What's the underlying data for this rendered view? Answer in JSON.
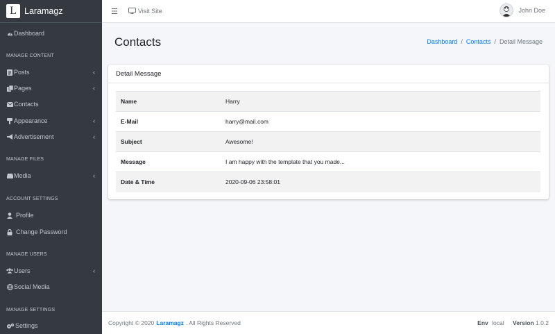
{
  "brand": {
    "logo_letter": "L",
    "name": "Laramagz"
  },
  "sidebar": {
    "dashboard": "Dashboard",
    "sections": {
      "content": "MANAGE CONTENT",
      "files": "MANAGE FILES",
      "account": "ACCOUNT SETTINGS",
      "users": "MANAGE USERS",
      "settings": "MANAGE SETTINGS"
    },
    "items": {
      "posts": "Posts",
      "pages": "Pages",
      "contacts": "Contacts",
      "appearance": "Appearance",
      "advertisement": "Advertisement",
      "media": "Media",
      "profile": "Profile",
      "change_password": "Change Password",
      "users": "Users",
      "social_media": "Social Media",
      "settings": "Settings"
    }
  },
  "topbar": {
    "visit_site": "Visit Site",
    "user_name": "John Doe"
  },
  "header": {
    "title": "Contacts",
    "breadcrumb": {
      "home": "Dashboard",
      "section": "Contacts",
      "current": "Detail Message",
      "separator": "/"
    }
  },
  "card": {
    "title": "Detail Message",
    "rows": [
      {
        "label": "Name",
        "value": "Harry"
      },
      {
        "label": "E-Mail",
        "value": "harry@mail.com"
      },
      {
        "label": "Subject",
        "value": "Awesome!"
      },
      {
        "label": "Message",
        "value": "I am happy with the template that you made..."
      },
      {
        "label": "Date & Time",
        "value": "2020-09-06 23:58:01"
      }
    ]
  },
  "footer": {
    "copyright_prefix": "Copyright © 2020",
    "brand": "Laramagz",
    "suffix": ". All Rights Reserved",
    "env_label": "Env",
    "env_value": "local",
    "version_label": "Version",
    "version_value": "1.0.2"
  }
}
